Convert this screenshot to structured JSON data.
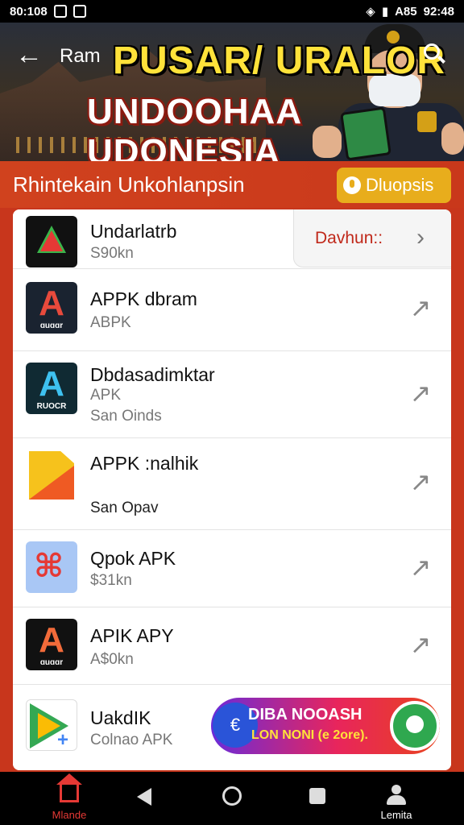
{
  "status_bar": {
    "time_left": "80:108",
    "time_right": "92:48",
    "battery_text": "A85"
  },
  "header": {
    "back_label": "←",
    "label": "Ram",
    "title_line1": "PUSAR/ URALOR",
    "title_line2": "UNDOOHAA UDONESIA"
  },
  "subheader": {
    "title": "Rhintekain Unkohlanpsin",
    "chip_label": "Dluopsis"
  },
  "list": {
    "items": [
      {
        "name": "Undarlatrb",
        "sub1": "S90kn",
        "sub2": "",
        "action_label": "Davhun::",
        "icon": "green-triangle-icon"
      },
      {
        "name": "APPK dbram",
        "sub1": "ABPK",
        "sub2": "",
        "icon": "apkmirror-a-icon"
      },
      {
        "name": "Dbdasadimktar",
        "sub1": "APK",
        "sub2": "San Oinds",
        "icon": "apkpure-a-icon"
      },
      {
        "name": "APPK :nalhik",
        "sub1": "",
        "sub2": "San Opav",
        "icon": "file-icon"
      },
      {
        "name": "Qpok APK",
        "sub1": "$31kn",
        "sub2": "",
        "icon": "blue-app-icon"
      },
      {
        "name": "APIK APY",
        "sub1": "A$0kn",
        "sub2": "",
        "icon": "apk-a-icon"
      },
      {
        "name": "UakdIK",
        "sub1": "Colnao APK",
        "sub2": "",
        "icon": "play-store-icon"
      }
    ]
  },
  "icons": {
    "icon_caption": "ɑuɑɑr",
    "icon_caption_2": "RUOCR"
  },
  "ad": {
    "line1": "DIBA NOOASH",
    "line2": "LON NONI (e 2ore).",
    "left_glyph": "€"
  },
  "bottom_nav": {
    "home_label": "Mlande",
    "account_label": "Lemita"
  },
  "colors": {
    "brand_red": "#c8361c",
    "accent_yellow": "#e8ad1c",
    "title_yellow": "#ffe23a"
  }
}
